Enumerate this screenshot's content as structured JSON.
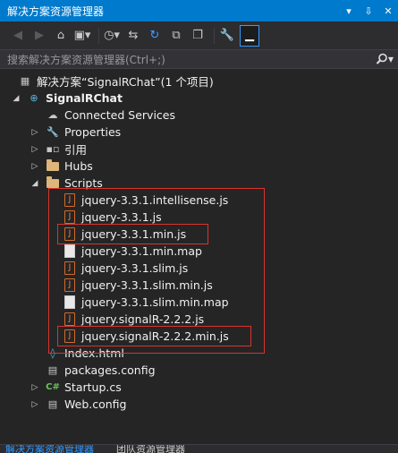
{
  "window": {
    "title": "解决方案资源管理器",
    "buttons": [
      "▾",
      "✕",
      "⇩",
      "✕"
    ]
  },
  "toolbar": {
    "icons": [
      "back-icon",
      "forward-icon",
      "home-icon",
      "switch-views-icon",
      "history-icon",
      "sync-icon",
      "refresh-icon",
      "collapse-all-icon",
      "show-all-files-icon",
      "properties-icon",
      "preview-icon"
    ]
  },
  "search": {
    "placeholder": "搜索解决方案资源管理器(Ctrl+;)"
  },
  "tree": {
    "solution": "解决方案“SignalRChat”(1 个项目)",
    "project": "SignalRChat",
    "items": [
      {
        "label": "Connected Services"
      },
      {
        "label": "Properties"
      },
      {
        "label": "引用"
      },
      {
        "label": "Hubs"
      },
      {
        "label": "Scripts"
      }
    ],
    "scripts": [
      "jquery-3.3.1.intellisense.js",
      "jquery-3.3.1.js",
      "jquery-3.3.1.min.js",
      "jquery-3.3.1.min.map",
      "jquery-3.3.1.slim.js",
      "jquery-3.3.1.slim.min.js",
      "jquery-3.3.1.slim.min.map",
      "jquery.signalR-2.2.2.js",
      "jquery.signalR-2.2.2.min.js"
    ],
    "files": [
      "Index.html",
      "packages.config",
      "Startup.cs",
      "Web.config"
    ]
  },
  "tabs": [
    "解决方案资源管理器",
    "团队资源管理器"
  ],
  "colors": {
    "accent": "#007acc",
    "highlight_border": "#d9342b",
    "folder": "#dcb67a",
    "js": "#e8824a"
  }
}
